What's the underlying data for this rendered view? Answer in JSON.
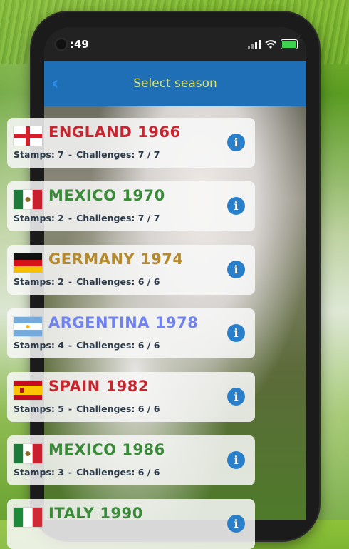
{
  "status_bar": {
    "time": ":49"
  },
  "nav": {
    "title": "Select season"
  },
  "seasons": [
    {
      "name": "ENGLAND 1966",
      "stamps": "Stamps: 7",
      "challenges": "Challenges: 7 / 7",
      "color": "#c9252f",
      "flag": "england-flag"
    },
    {
      "name": "MEXICO 1970",
      "stamps": "Stamps: 2",
      "challenges": "Challenges: 7 / 7",
      "color": "#3a8a3a",
      "flag": "mexico-flag"
    },
    {
      "name": "GERMANY 1974",
      "stamps": "Stamps: 2",
      "challenges": "Challenges: 6 / 6",
      "color": "#b58a2e",
      "flag": "germany-flag"
    },
    {
      "name": "ARGENTINA 1978",
      "stamps": "Stamps: 4",
      "challenges": "Challenges: 6 / 6",
      "color": "#6f82f0",
      "flag": "argentina-flag"
    },
    {
      "name": "SPAIN 1982",
      "stamps": "Stamps: 5",
      "challenges": "Challenges: 6 / 6",
      "color": "#c9252f",
      "flag": "spain-flag"
    },
    {
      "name": "MEXICO 1986",
      "stamps": "Stamps: 3",
      "challenges": "Challenges: 6 / 6",
      "color": "#3a8a3a",
      "flag": "mexico-flag"
    },
    {
      "name": "ITALY 1990",
      "stamps": "",
      "challenges": "",
      "color": "#3a8a3a",
      "flag": "italy-flag"
    }
  ],
  "separator": "-",
  "colors": {
    "nav_bg": "#1e6fb6",
    "nav_title": "#e3e35a",
    "info_button": "#2a7fcb"
  },
  "icons": {
    "back": "chevron-left-icon",
    "info": "info-icon"
  }
}
